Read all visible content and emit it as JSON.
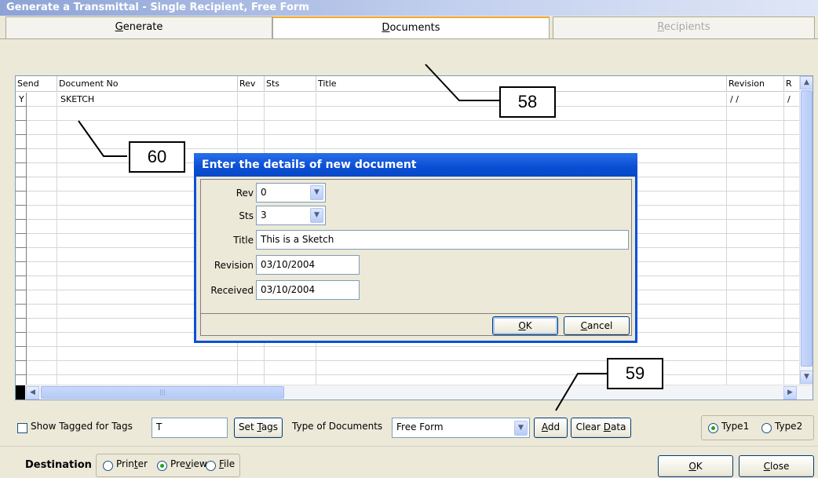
{
  "window": {
    "title": "Generate a Transmittal - Single Recipient, Free Form"
  },
  "tabs": [
    {
      "label": "Generate",
      "state": "normal"
    },
    {
      "label": "Documents",
      "state": "active"
    },
    {
      "label": "Recipients",
      "state": "disabled"
    }
  ],
  "grid": {
    "columns": [
      "Send",
      "Document No",
      "Rev",
      "Sts",
      "Title",
      "Revision",
      "R"
    ],
    "rows": [
      {
        "send": "Y",
        "document_no": "SKETCH",
        "rev": "",
        "sts": "",
        "title": "",
        "revision": "/ /",
        "r": "/"
      }
    ]
  },
  "dialog": {
    "title": "Enter the details of new document",
    "rev_label": "Rev",
    "rev_value": "0",
    "sts_label": "Sts",
    "sts_value": "3",
    "title_label": "Title",
    "title_value": "This is a Sketch",
    "revision_label": "Revision",
    "revision_value": "03/10/2004",
    "received_label": "Received",
    "received_value": "03/10/2004",
    "ok_label": "OK",
    "cancel_label": "Cancel"
  },
  "toolbar": {
    "show_tagged_label": "Show Tagged for Tags",
    "tags_value": "T",
    "set_tags_label": "Set Tags",
    "type_of_documents_label": "Type of Documents",
    "type_of_documents_value": "Free Form",
    "add_label": "Add",
    "clear_data_label": "Clear Data",
    "type1_label": "Type1",
    "type2_label": "Type2",
    "selected_type": "Type1"
  },
  "footer": {
    "destination_label": "Destination",
    "printer_label": "Printer",
    "preview_label": "Preview",
    "file_label": "File",
    "selected_destination": "Preview",
    "ok_label": "OK",
    "close_label": "Close"
  },
  "callouts": [
    "58",
    "59",
    "60"
  ],
  "colors": {
    "dialog_title": "#0a4ed4",
    "active_tab_accent": "#f0a72a",
    "titlebar": "#8da3d6"
  }
}
